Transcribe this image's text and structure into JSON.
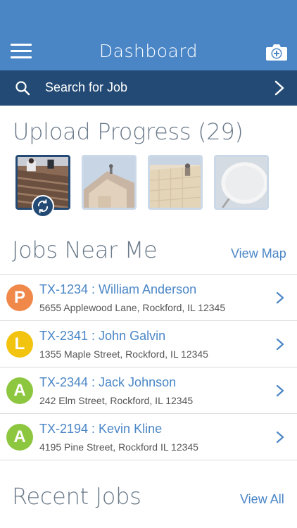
{
  "header": {
    "title": "Dashboard",
    "menu_icon": "hamburger-menu-icon",
    "camera_icon": "camera-add-icon",
    "color": "#4a86c6"
  },
  "search": {
    "label": "Search for Job",
    "icon": "search-icon",
    "color": "#234a74"
  },
  "upload": {
    "title": "Upload Progress (29)",
    "thumbnails": [
      {
        "subject": "roof shingles with workers",
        "state": "uploading"
      },
      {
        "subject": "house roof with workers",
        "state": "pending"
      },
      {
        "subject": "roof decking with workers",
        "state": "pending"
      },
      {
        "subject": "satellite dish",
        "state": "pending"
      }
    ]
  },
  "jobs_near_me": {
    "title": "Jobs Near Me",
    "link": "View Map",
    "items": [
      {
        "badge": "P",
        "badge_color": "#f0884a",
        "title": "TX-1234 : William Anderson",
        "address": "5655 Applewood Lane, Rockford, IL 12345"
      },
      {
        "badge": "L",
        "badge_color": "#f2c40f",
        "title": "TX-2341 : John Galvin",
        "address": "1355 Maple Street, Rockford, IL 12345"
      },
      {
        "badge": "A",
        "badge_color": "#8dc63f",
        "title": "TX-2344 : Jack Johnson",
        "address": "242 Elm Street, Rockford, IL 12345"
      },
      {
        "badge": "A",
        "badge_color": "#8dc63f",
        "title": "TX-2194 : Kevin Kline",
        "address": "4195 Pine Street, Rockford IL 12345"
      }
    ]
  },
  "recent_jobs": {
    "title": "Recent Jobs",
    "link": "View All"
  }
}
